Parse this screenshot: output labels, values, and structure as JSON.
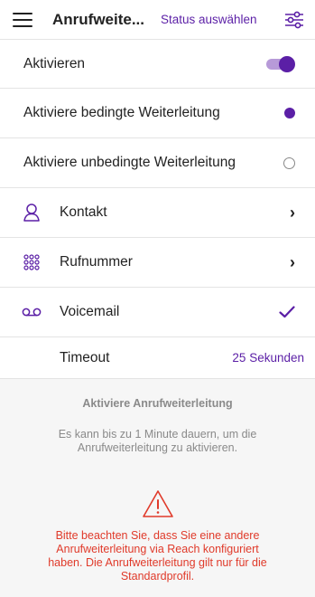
{
  "header": {
    "title": "Anrufweite...",
    "status_select": "Status auswählen",
    "menu_icon": "hamburger-menu-icon",
    "filter_icon": "sliders-icon"
  },
  "rows": {
    "activate": {
      "label": "Aktivieren",
      "toggle_on": true
    },
    "conditional": {
      "label": "Aktiviere bedingte Weiterleitung",
      "selected": true
    },
    "unconditional": {
      "label": "Aktiviere unbedingte Weiterleitung",
      "selected": false
    },
    "contact": {
      "label": "Kontakt",
      "icon": "person-icon"
    },
    "number": {
      "label": "Rufnummer",
      "icon": "dialpad-icon"
    },
    "voicemail": {
      "label": "Voicemail",
      "icon": "voicemail-icon",
      "checked": true
    },
    "timeout": {
      "label": "Timeout",
      "value": "25 Sekunden"
    }
  },
  "info": {
    "title": "Aktiviere Anrufweiterleitung",
    "text": "Es kann bis zu 1 Minute dauern, um die Anrufweiterleitung zu aktivieren.",
    "warning_icon": "warning-triangle-icon",
    "warning": "Bitte beachten Sie, dass Sie eine andere Anrufweiterleitung via Reach konfiguriert haben. Die Anrufweiterleitung gilt nur für die Standardprofil."
  },
  "colors": {
    "accent": "#5b1fa6",
    "accent_light": "#b79ad8",
    "warning": "#e03a2a",
    "muted_text": "#8a8a8a"
  }
}
